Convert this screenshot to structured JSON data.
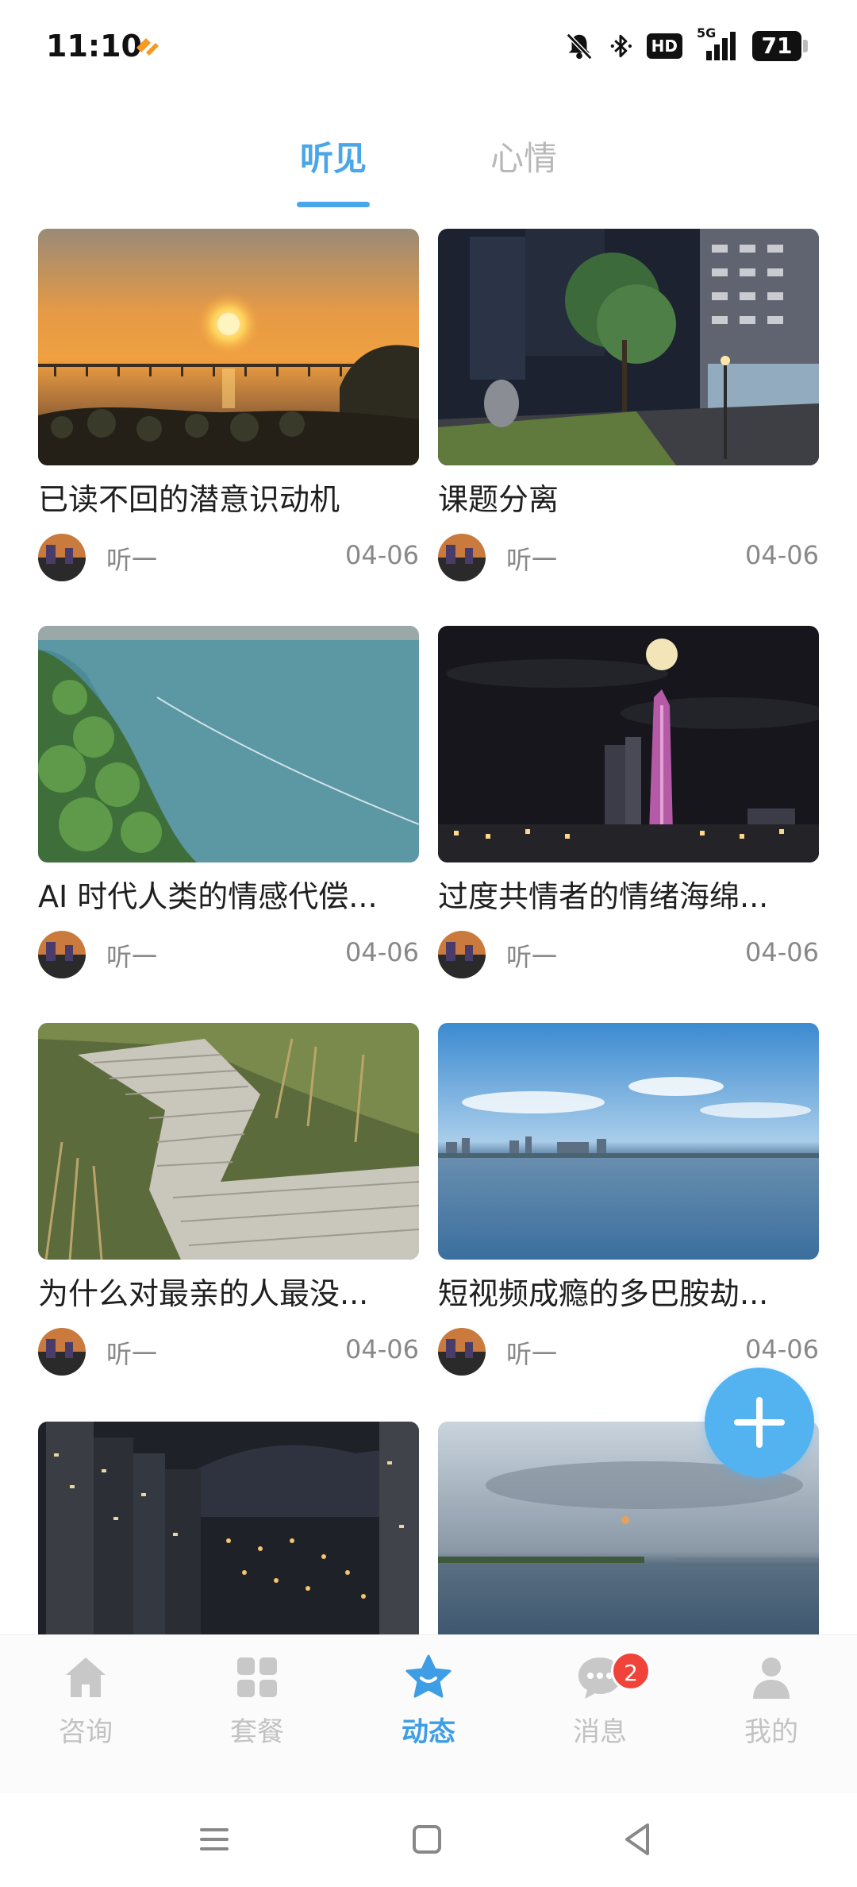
{
  "status_bar": {
    "time": "11:10",
    "hd_label": "HD",
    "network": "5G",
    "battery": "71"
  },
  "tabs": [
    {
      "label": "听见",
      "active": true
    },
    {
      "label": "心情",
      "active": false
    }
  ],
  "cards": [
    {
      "title": "已读不回的潜意识动机",
      "author": "听一",
      "date": "04-06"
    },
    {
      "title": "课题分离",
      "author": "听一",
      "date": "04-06"
    },
    {
      "title": "AI 时代人类的情感代偿...",
      "author": "听一",
      "date": "04-06"
    },
    {
      "title": "过度共情者的情绪海绵...",
      "author": "听一",
      "date": "04-06"
    },
    {
      "title": "为什么对最亲的人最没...",
      "author": "听一",
      "date": "04-06"
    },
    {
      "title": "短视频成瘾的多巴胺劫...",
      "author": "听一",
      "date": "04-06"
    },
    {
      "title": "",
      "author": "",
      "date": ""
    },
    {
      "title": "",
      "author": "",
      "date": ""
    }
  ],
  "fab": {
    "icon": "plus-icon"
  },
  "bottom_nav": [
    {
      "label": "咨询",
      "icon": "home-icon",
      "active": false
    },
    {
      "label": "套餐",
      "icon": "grid-icon",
      "active": false
    },
    {
      "label": "动态",
      "icon": "star-icon",
      "active": true
    },
    {
      "label": "消息",
      "icon": "chat-icon",
      "active": false,
      "badge": "2"
    },
    {
      "label": "我的",
      "icon": "person-icon",
      "active": false
    }
  ],
  "colors": {
    "accent": "#4aa6e8",
    "inactive": "#c2c2c2",
    "badge": "#f0433a"
  }
}
